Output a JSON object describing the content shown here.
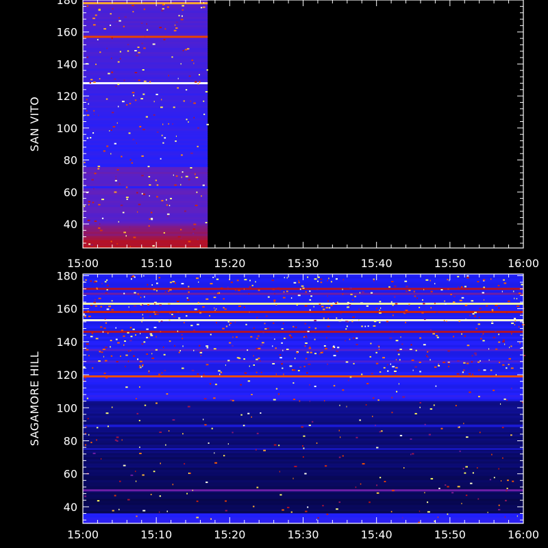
{
  "chart_data": [
    {
      "type": "heatmap",
      "ylabel": "SAN VITO",
      "x_ticks": [
        "15:00",
        "15:10",
        "15:20",
        "15:30",
        "15:40",
        "15:50",
        "16:00"
      ],
      "y_ticks": [
        "40",
        "60",
        "80",
        "100",
        "120",
        "140",
        "160",
        "180"
      ],
      "xlim": [
        "15:00",
        "16:00"
      ],
      "ylim": [
        25,
        180
      ],
      "data_end_time": "15:17",
      "colormap": [
        "#000000",
        "#0a0a6e",
        "#2020ff",
        "#6020c0",
        "#c01010",
        "#ff6000",
        "#ffff60",
        "#ffffff"
      ],
      "background_level": 0.35,
      "bands": [
        {
          "y": 178,
          "level": 0.78
        },
        {
          "y": 157,
          "level": 0.66
        },
        {
          "y": 128,
          "level": 1.0
        },
        {
          "y": 75,
          "level": 0.42
        },
        {
          "y": 63,
          "level": 0.3
        },
        {
          "y": 28,
          "level": 0.55
        }
      ]
    },
    {
      "type": "heatmap",
      "ylabel": "SAGAMORE  HILL",
      "x_ticks": [
        "15:00",
        "15:10",
        "15:20",
        "15:30",
        "15:40",
        "15:50",
        "16:00"
      ],
      "y_ticks": [
        "40",
        "60",
        "80",
        "100",
        "120",
        "140",
        "160",
        "180"
      ],
      "xlim": [
        "15:00",
        "16:00"
      ],
      "ylim": [
        30,
        181
      ],
      "colormap": [
        "#000000",
        "#0a0a6e",
        "#2020ff",
        "#6020c0",
        "#c01010",
        "#ff6000",
        "#ffff60",
        "#ffffff"
      ],
      "background_level": 0.12,
      "bands": [
        {
          "y": 172,
          "level": 0.55
        },
        {
          "y": 169,
          "level": 0.45
        },
        {
          "y": 163,
          "level": 0.92
        },
        {
          "y": 158,
          "level": 0.6
        },
        {
          "y": 153,
          "level": 0.97
        },
        {
          "y": 146,
          "level": 0.55
        },
        {
          "y": 135,
          "level": 0.4
        },
        {
          "y": 128,
          "level": 0.38
        },
        {
          "y": 119,
          "level": 0.68
        },
        {
          "y": 107,
          "level": 0.32
        },
        {
          "y": 89,
          "level": 0.25
        },
        {
          "y": 75,
          "level": 0.22
        },
        {
          "y": 50,
          "level": 0.45
        }
      ]
    }
  ]
}
